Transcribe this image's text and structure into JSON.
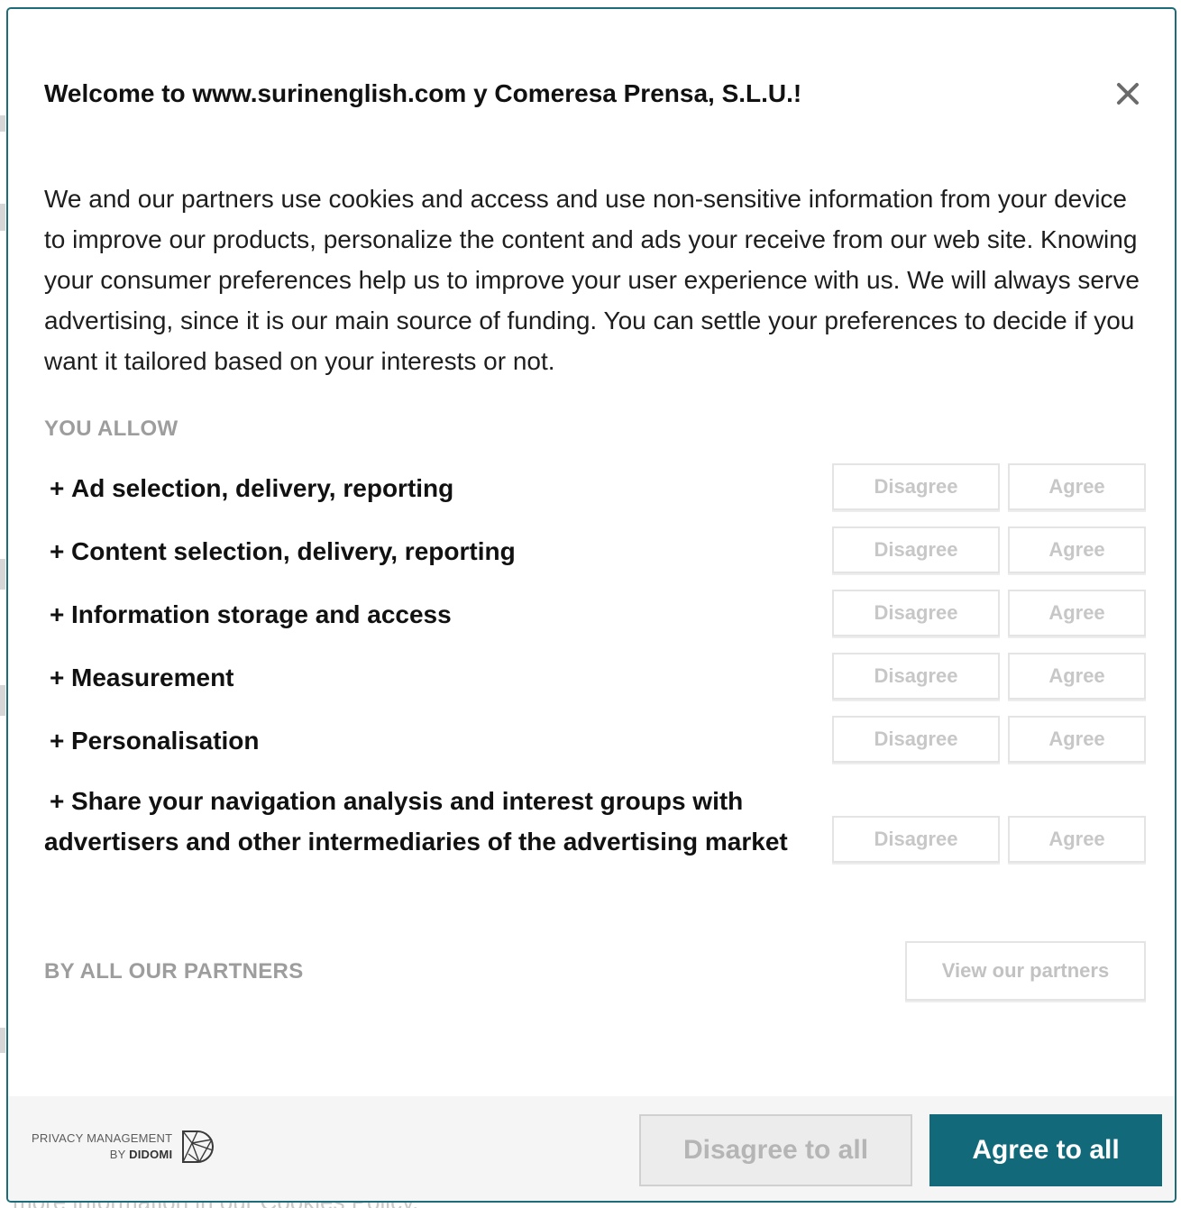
{
  "background": {
    "peek_text": "more information in our Cookies Policy."
  },
  "modal": {
    "title": "Welcome to www.surinenglish.com y Comeresa Prensa, S.L.U.!",
    "close_icon": "close-icon",
    "intro": "We and our partners use cookies and access and use non-sensitive information from your device to improve our products, personalize the content and ads your receive from our web site. Knowing your consumer preferences help us to improve your user experience with us. We will always serve advertising, since it is our main source of funding. You can settle your preferences to decide if you want it tailored based on your interests or not.",
    "you_allow_label": "YOU ALLOW",
    "expand_symbol": "+",
    "purposes": [
      {
        "label": "Ad selection, delivery, reporting",
        "disagree": "Disagree",
        "agree": "Agree"
      },
      {
        "label": "Content selection, delivery, reporting",
        "disagree": "Disagree",
        "agree": "Agree"
      },
      {
        "label": "Information storage and access",
        "disagree": "Disagree",
        "agree": "Agree"
      },
      {
        "label": "Measurement",
        "disagree": "Disagree",
        "agree": "Agree"
      },
      {
        "label": "Personalisation",
        "disagree": "Disagree",
        "agree": "Agree"
      },
      {
        "label": "Share your navigation analysis and interest groups with advertisers and other intermediaries of the advertising market",
        "disagree": "Disagree",
        "agree": "Agree"
      }
    ],
    "partners_label": "BY ALL OUR PARTNERS",
    "view_partners": "View our partners"
  },
  "footer": {
    "privacy_line1": "PRIVACY MANAGEMENT",
    "privacy_by": "BY",
    "privacy_brand": "DIDOMI",
    "logo_icon": "didomi-logo-icon",
    "disagree_all": "Disagree to all",
    "agree_all": "Agree to all"
  },
  "colors": {
    "accent": "#12697a",
    "modal_border": "#1c6c79",
    "muted_label": "#9d9d9d",
    "footer_bg": "#f5f5f5"
  }
}
